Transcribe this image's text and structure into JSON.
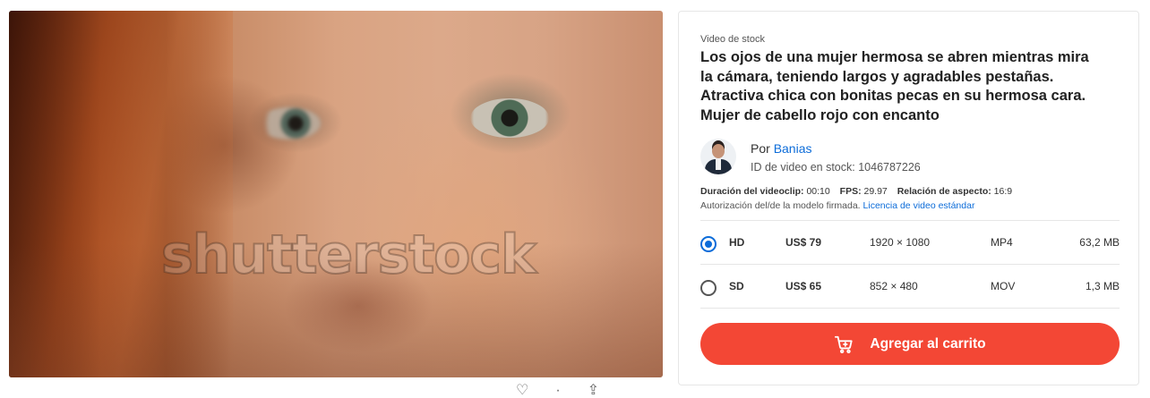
{
  "preview": {
    "watermark": "shutterstock"
  },
  "details": {
    "kicker": "Video de stock",
    "title": "Los ojos de una mujer hermosa se abren mientras mira la cámara, teniendo largos y agradables pestañas. Atractiva chica con bonitas pecas en su hermosa cara. Mujer de cabello rojo con encanto",
    "author_prefix": "Por",
    "author_name": "Banias",
    "stock_id_label": "ID de video en stock:",
    "stock_id": "1046787226",
    "duration_label": "Duración del videoclip:",
    "duration": "00:10",
    "fps_label": "FPS:",
    "fps": "29.97",
    "aspect_label": "Relación de aspecto:",
    "aspect": "16:9",
    "authorization": "Autorización del/de la modelo firmada.",
    "license_link": "Licencia de video estándar"
  },
  "options": [
    {
      "quality": "HD",
      "price": "US$ 79",
      "resolution": "1920 × 1080",
      "format": "MP4",
      "size": "63,2 MB",
      "selected": true
    },
    {
      "quality": "SD",
      "price": "US$ 65",
      "resolution": "852 × 480",
      "format": "MOV",
      "size": "1,3 MB",
      "selected": false
    }
  ],
  "cart_button": {
    "label": "Agregar al carrito",
    "color": "#f34735"
  },
  "colors": {
    "link": "#0c6cd9",
    "radio_selected": "#0c6cd9"
  },
  "icons": [
    "heart-icon",
    "share-icon",
    "cart-icon"
  ]
}
